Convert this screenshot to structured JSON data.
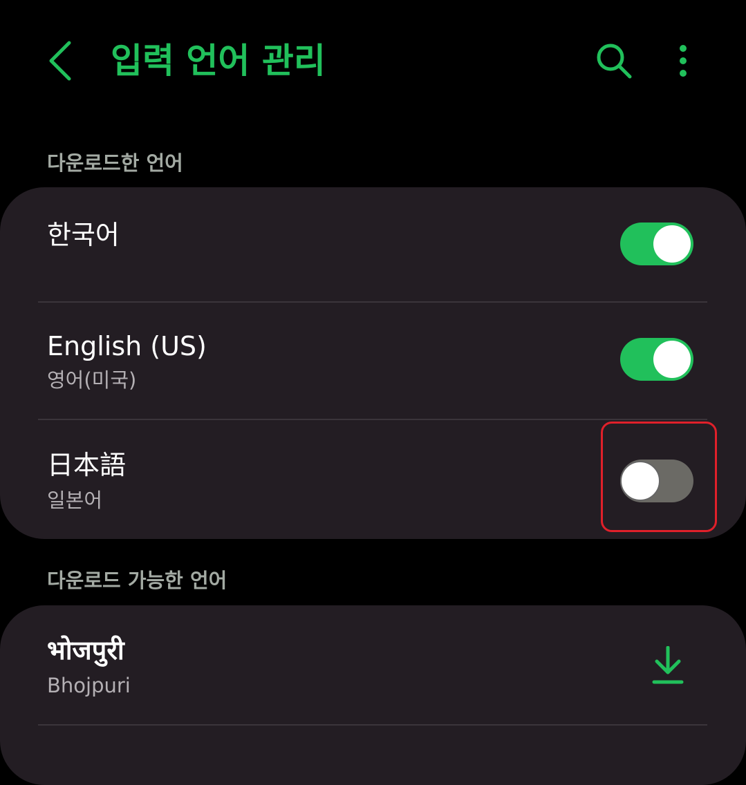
{
  "colors": {
    "accent": "#21c05b",
    "background": "#000000",
    "card": "#231d23",
    "section_header": "#a3aaa3",
    "subtitle": "#b4b0b4",
    "toggle_off_track": "#6b6a65",
    "highlight": "#e0202a"
  },
  "header": {
    "title": "입력 언어 관리",
    "back_icon": "chevron-left-icon",
    "search_icon": "search-icon",
    "more_icon": "more-vertical-icon"
  },
  "downloaded_section": {
    "header": "다운로드한 언어",
    "languages": [
      {
        "title": "한국어",
        "subtitle": "",
        "enabled": true
      },
      {
        "title": "English (US)",
        "subtitle": "영어(미국)",
        "enabled": true
      },
      {
        "title": "日本語",
        "subtitle": "일본어",
        "enabled": false
      }
    ]
  },
  "available_section": {
    "header": "다운로드 가능한 언어",
    "languages": [
      {
        "title": "भोजपुरी",
        "subtitle": "Bhojpuri",
        "action_icon": "download-icon"
      }
    ]
  }
}
